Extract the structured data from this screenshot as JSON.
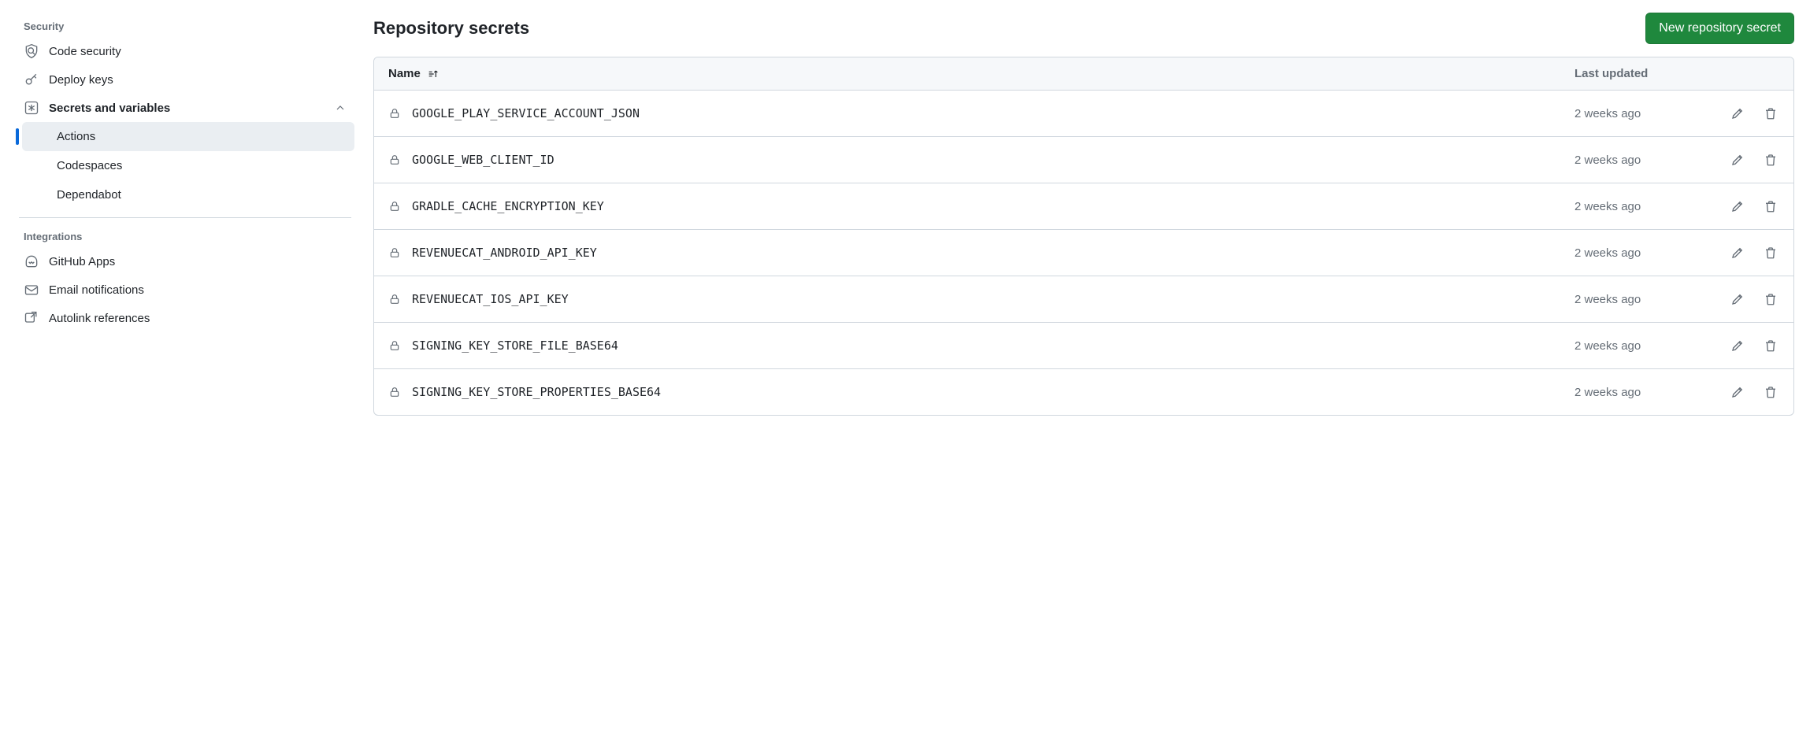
{
  "sidebar": {
    "sections": [
      {
        "header": "Security",
        "items": [
          {
            "label": "Code security",
            "icon": "shield-scan"
          },
          {
            "label": "Deploy keys",
            "icon": "key"
          },
          {
            "label": "Secrets and variables",
            "icon": "asterisk",
            "expanded": true,
            "children": [
              {
                "label": "Actions",
                "active": true
              },
              {
                "label": "Codespaces"
              },
              {
                "label": "Dependabot"
              }
            ]
          }
        ]
      },
      {
        "header": "Integrations",
        "items": [
          {
            "label": "GitHub Apps",
            "icon": "hubot"
          },
          {
            "label": "Email notifications",
            "icon": "mail"
          },
          {
            "label": "Autolink references",
            "icon": "crossref"
          }
        ]
      }
    ]
  },
  "main": {
    "title": "Repository secrets",
    "new_button": "New repository secret",
    "columns": {
      "name": "Name",
      "updated": "Last updated"
    },
    "secrets": [
      {
        "name": "GOOGLE_PLAY_SERVICE_ACCOUNT_JSON",
        "updated": "2 weeks ago"
      },
      {
        "name": "GOOGLE_WEB_CLIENT_ID",
        "updated": "2 weeks ago"
      },
      {
        "name": "GRADLE_CACHE_ENCRYPTION_KEY",
        "updated": "2 weeks ago"
      },
      {
        "name": "REVENUECAT_ANDROID_API_KEY",
        "updated": "2 weeks ago"
      },
      {
        "name": "REVENUECAT_IOS_API_KEY",
        "updated": "2 weeks ago"
      },
      {
        "name": "SIGNING_KEY_STORE_FILE_BASE64",
        "updated": "2 weeks ago"
      },
      {
        "name": "SIGNING_KEY_STORE_PROPERTIES_BASE64",
        "updated": "2 weeks ago"
      }
    ]
  }
}
